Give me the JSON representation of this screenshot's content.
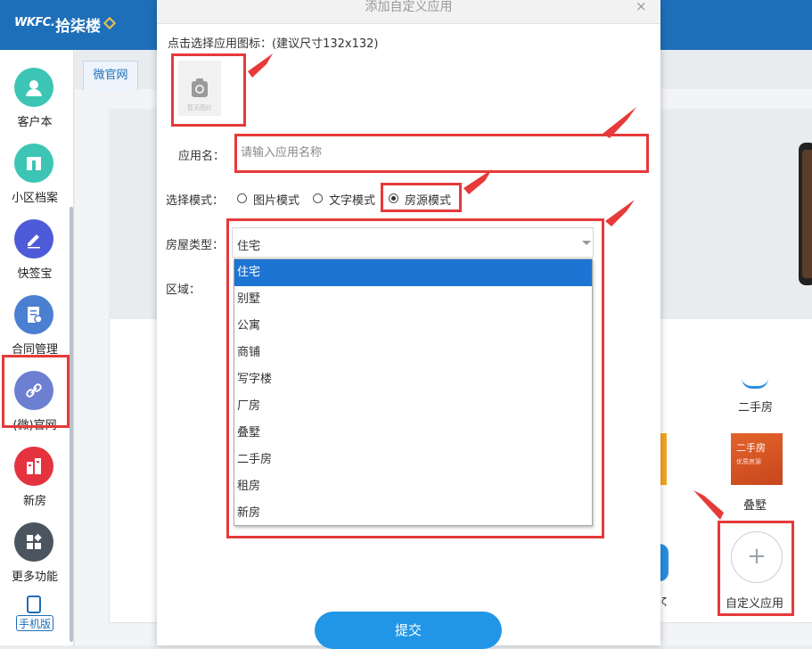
{
  "app": {
    "logo_text": "WKFC.",
    "brand_name": "拾柒楼"
  },
  "sidebar": {
    "items": [
      {
        "label": "客户本",
        "icon": "contacts-icon",
        "color": "#3cc5b4"
      },
      {
        "label": "小区档案",
        "icon": "building-archive-icon",
        "color": "#3cc5b4"
      },
      {
        "label": "快签宝",
        "icon": "sign-pen-icon",
        "color": "#4e5bd8"
      },
      {
        "label": "合同管理",
        "icon": "contract-icon",
        "color": "#4a7fd1"
      },
      {
        "label": "(微)官网",
        "icon": "link-icon",
        "color": "#6c7fd1"
      },
      {
        "label": "新房",
        "icon": "new-house-icon",
        "color": "#e5323f"
      },
      {
        "label": "更多功能",
        "icon": "more-apps-icon",
        "color": "#4b5560"
      }
    ],
    "mobile_label": "手机版"
  },
  "background": {
    "tab_label": "微官网",
    "tile_label_top": "二手房",
    "tile_label_mid": "叠墅",
    "tile_label_bottom": "自定义应用",
    "thumb_title": "二手房",
    "thumb_sub": "优质房源",
    "plus_symbol": "+",
    "partial_label": "ζ"
  },
  "dialog": {
    "title": "添加自定义应用",
    "close_symbol": "×",
    "icon_prompt": "点击选择应用图标：(建议尺寸132x132)",
    "image_placeholder": "暂无图片",
    "app_name_label": "应用名：",
    "app_name_placeholder": "请输入应用名称",
    "mode_label": "选择模式：",
    "modes": [
      {
        "label": "图片模式",
        "checked": false
      },
      {
        "label": "文字模式",
        "checked": false
      },
      {
        "label": "房源模式",
        "checked": true
      }
    ],
    "house_type_label": "房屋类型：",
    "house_type_value": "住宅",
    "house_type_options": [
      "住宅",
      "别墅",
      "公寓",
      "商铺",
      "写字楼",
      "厂房",
      "叠墅",
      "二手房",
      "租房",
      "新房"
    ],
    "region_label": "区域：",
    "submit_label": "提交"
  }
}
